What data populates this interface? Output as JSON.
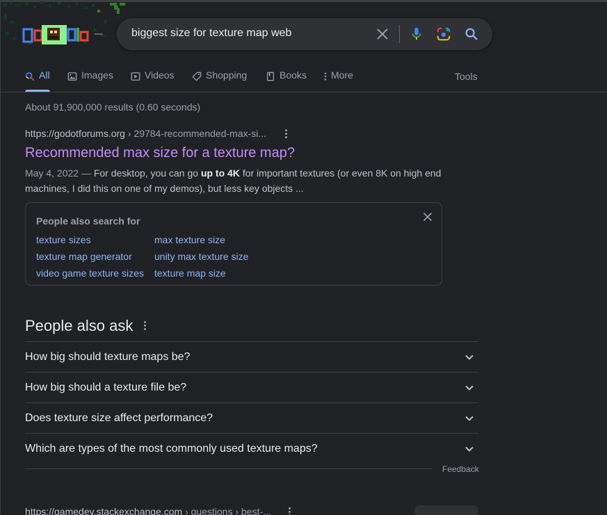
{
  "search": {
    "query": "biggest size for texture map web"
  },
  "tabs": [
    {
      "label": "All",
      "icon": "search-icon",
      "active": true
    },
    {
      "label": "Images",
      "icon": "image-icon"
    },
    {
      "label": "Videos",
      "icon": "play-icon"
    },
    {
      "label": "Shopping",
      "icon": "tag-icon"
    },
    {
      "label": "Books",
      "icon": "book-icon"
    },
    {
      "label": "More",
      "icon": "kebab-icon"
    }
  ],
  "tools_label": "Tools",
  "result_stats": "About 91,900,000 results (0.60 seconds)",
  "result1": {
    "site": "https://godotforums.org",
    "path": " › 29784-recommended-max-si...",
    "title": "Recommended max size for a texture map?",
    "date": "May 4, 2022",
    "dash": " — ",
    "snippet_pre": "For desktop, you can go ",
    "snippet_bold": "up to 4K",
    "snippet_post": " for important textures (or even 8K on high end machines, I did this on one of my demos), but less key objects ..."
  },
  "people_also_search": {
    "title": "People also search for",
    "links": [
      "texture sizes",
      "max texture size",
      "texture map generator",
      "unity max texture size",
      "video game texture sizes",
      "texture map size"
    ]
  },
  "people_also_ask": {
    "title": "People also ask",
    "questions": [
      "How big should texture maps be?",
      "How big should a texture file be?",
      "Does texture size affect performance?",
      "Which are types of the most commonly used texture maps?"
    ],
    "feedback_label": "Feedback"
  },
  "result2": {
    "site": "https://gamedev.stackexchange.com",
    "path": " › questions › best-..."
  },
  "colors": {
    "background": "#202124",
    "link": "#8ab4f8",
    "visited": "#c58af9",
    "text": "#bdc1c6",
    "muted": "#9aa0a6"
  }
}
